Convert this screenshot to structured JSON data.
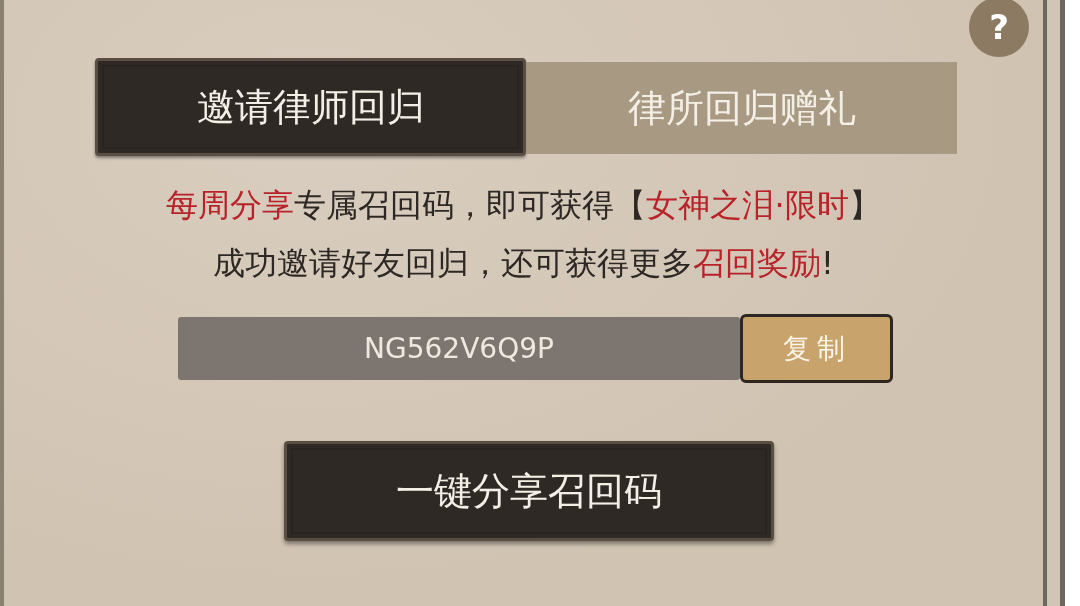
{
  "help_button": {
    "label": "?"
  },
  "tabs": [
    {
      "label": "邀请律师回归",
      "selected": true
    },
    {
      "label": "律所回归赠礼",
      "selected": false
    }
  ],
  "description": [
    [
      {
        "text": "每周分享",
        "highlight": true
      },
      {
        "text": "专属召回码，即可获得【",
        "highlight": false
      },
      {
        "text": "女神之泪·限时",
        "highlight": true
      },
      {
        "text": "】",
        "highlight": false
      }
    ],
    [
      {
        "text": "成功邀请好友回归，还可获得更多",
        "highlight": false
      },
      {
        "text": "召回奖励",
        "highlight": true
      },
      {
        "text": "!",
        "highlight": false
      }
    ]
  ],
  "recall_code": {
    "value": "NG562V6Q9P",
    "copy_label": "复制"
  },
  "share_button": {
    "label": "一键分享召回码"
  }
}
